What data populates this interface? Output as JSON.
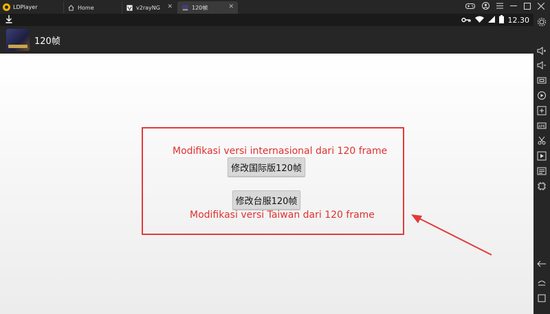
{
  "window": {
    "app_name": "LDPlayer",
    "tabs": [
      {
        "label": "Home"
      },
      {
        "label": "v2rayNG"
      },
      {
        "label": "120帧"
      }
    ]
  },
  "statusbar": {
    "time": "12.30"
  },
  "appbar": {
    "title": "120帧"
  },
  "content": {
    "international_caption": "Modifikasi versi internasional dari 120 frame",
    "international_button": "修改国际版120帧",
    "taiwan_button": "修改台服120帧",
    "taiwan_caption": "Modifikasi versi Taiwan dari 120 frame"
  },
  "colors": {
    "annotation_red": "#e23a3a",
    "titlebar_bg": "#262626"
  },
  "sidebar_icons": [
    "settings-icon",
    "volume-up-icon",
    "volume-down-icon",
    "screenshot-icon",
    "record-icon",
    "add-apk-icon",
    "install-apk-icon",
    "cut-icon",
    "play-icon",
    "folder-icon",
    "sync-icon",
    "back-icon",
    "home-icon",
    "recent-apps-icon"
  ]
}
